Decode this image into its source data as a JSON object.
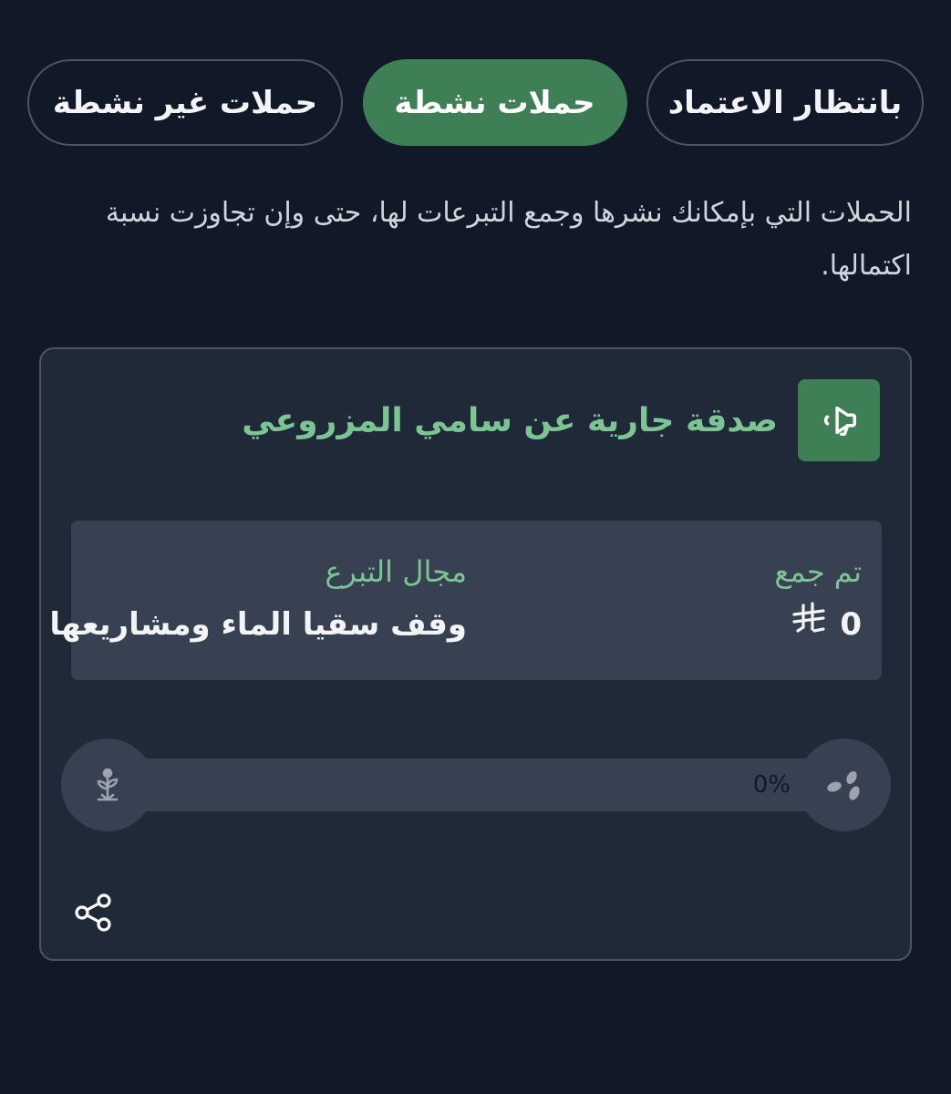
{
  "tabs": [
    {
      "label": "حملات غير نشطة",
      "active": false
    },
    {
      "label": "حملات نشطة",
      "active": true
    },
    {
      "label": "بانتظار الاعتماد",
      "active": false
    }
  ],
  "description": "الحملات التي بإمكانك نشرها وجمع التبرعات لها، حتى وإن تجاوزت نسبة اكتمالها.",
  "campaign": {
    "title": "صدقة جارية عن سامي المزروعي",
    "collected_label": "تم جمع",
    "collected_amount": "0",
    "currency_icon": "riyal-icon",
    "field_label": "مجال التبرع",
    "field_value": "وقف سقيا الماء ومشاريعها",
    "progress": 0,
    "progress_text": "0%"
  },
  "colors": {
    "accent": "#3f7f55",
    "accent_text": "#7cc494",
    "background": "#111827",
    "card": "#1f2937",
    "panel": "#374151"
  }
}
